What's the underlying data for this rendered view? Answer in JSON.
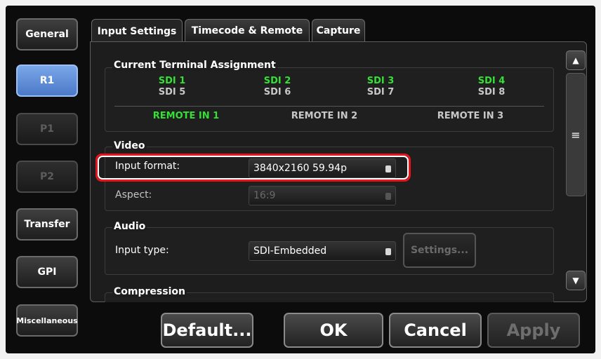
{
  "sidebar": {
    "items": [
      {
        "label": "General"
      },
      {
        "label": "R1"
      },
      {
        "label": "P1"
      },
      {
        "label": "P2"
      },
      {
        "label": "Transfer"
      },
      {
        "label": "GPI"
      },
      {
        "label": "Miscellaneous"
      }
    ],
    "active": "R1"
  },
  "tabs": [
    {
      "label": "Input Settings"
    },
    {
      "label": "Timecode & Remote"
    },
    {
      "label": "Capture"
    }
  ],
  "terminal": {
    "title": "Current Terminal Assignment",
    "sdi": [
      "SDI 1",
      "SDI 2",
      "SDI 3",
      "SDI 4",
      "SDI 5",
      "SDI 6",
      "SDI 7",
      "SDI 8"
    ],
    "remotes": [
      "REMOTE IN 1",
      "REMOTE IN 2",
      "REMOTE IN 3"
    ]
  },
  "video": {
    "title": "Video",
    "input_format_label": "Input format:",
    "input_format_value": "3840x2160 59.94p",
    "aspect_label": "Aspect:",
    "aspect_value": "16:9"
  },
  "audio": {
    "title": "Audio",
    "input_type_label": "Input type:",
    "input_type_value": "SDI-Embedded",
    "settings_label": "Settings..."
  },
  "compression": {
    "title": "Compression"
  },
  "footer": {
    "default_label": "Default...",
    "ok_label": "OK",
    "cancel_label": "Cancel",
    "apply_label": "Apply"
  },
  "colors": {
    "active_green": "#35e035",
    "highlight_red": "#e8141c",
    "active_blue": "#5b89d6"
  }
}
